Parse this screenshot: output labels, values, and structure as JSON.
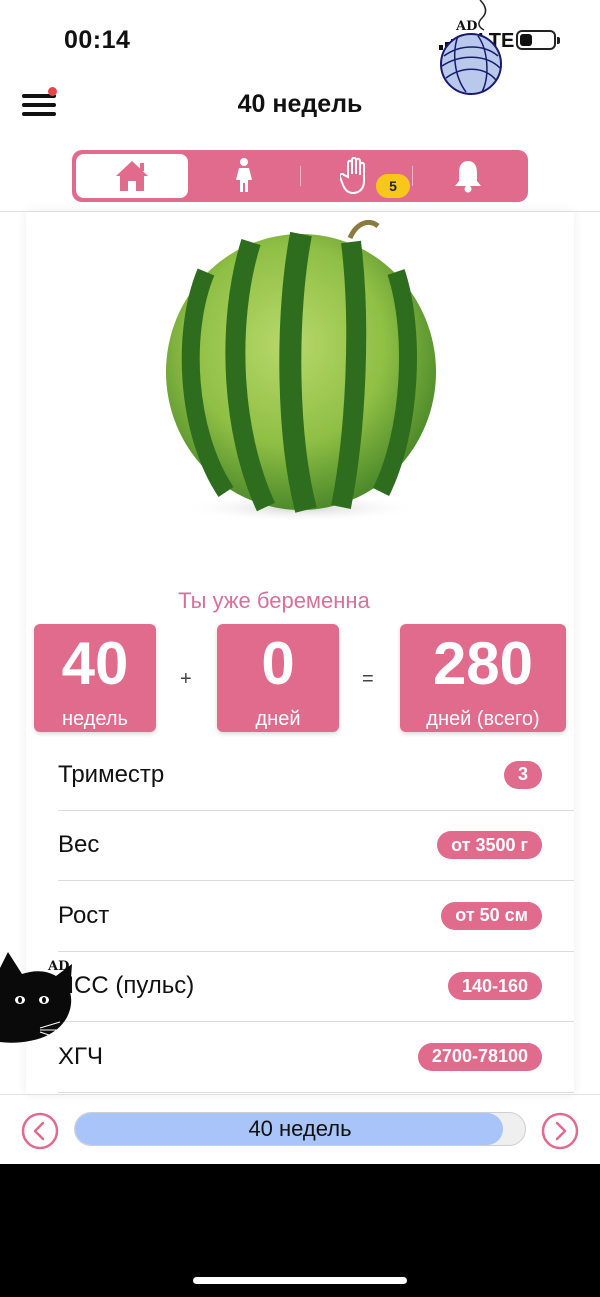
{
  "status_bar": {
    "time": "00:14",
    "network": "LTE",
    "ad_label": "AD"
  },
  "header": {
    "title": "40 недель",
    "menu_icon": "hamburger-menu-icon",
    "has_notification_dot": true
  },
  "tabs": [
    {
      "name": "home",
      "icon": "house-icon",
      "active": true
    },
    {
      "name": "woman",
      "icon": "woman-figure-icon",
      "active": false
    },
    {
      "name": "hand",
      "icon": "hand-icon",
      "active": false
    },
    {
      "name": "notifications",
      "icon": "bell-icon",
      "active": false,
      "badge": "5"
    }
  ],
  "colors": {
    "accent": "#e06b8c",
    "title_pink": "#d8709a",
    "badge_yellow": "#f7c81a",
    "progress_blue": "#a8c4f8"
  },
  "fruit_image": "watermelon",
  "pregnancy": {
    "title": "Ты уже беременна",
    "weeks": {
      "value": "40",
      "label": "недель"
    },
    "plus": "+",
    "days": {
      "value": "0",
      "label": "дней"
    },
    "equals": "=",
    "total": {
      "value": "280",
      "label": "дней (всего)"
    }
  },
  "details": [
    {
      "label": "Триместр",
      "value": "3"
    },
    {
      "label": "Вес",
      "value": "от 3500 г"
    },
    {
      "label": "Рост",
      "value": "от 50 см"
    },
    {
      "label": "ЧСС (пульс)",
      "value": "140-160"
    },
    {
      "label": "ХГЧ",
      "value": "2700-78100"
    }
  ],
  "ad_cat_label": "AD",
  "week_nav": {
    "label": "40 недель",
    "progress": 0.95,
    "prev_icon": "chevron-left-icon",
    "next_icon": "chevron-right-icon"
  }
}
